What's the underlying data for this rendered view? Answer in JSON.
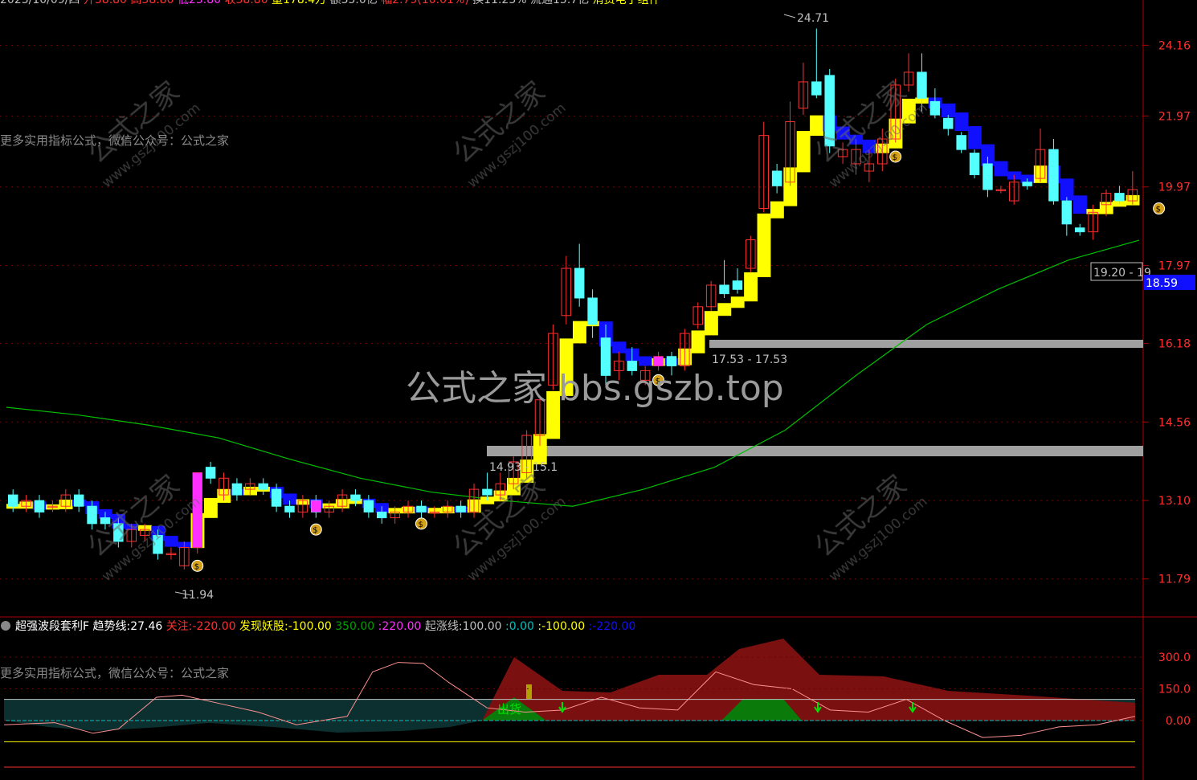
{
  "header": {
    "date": "2023/10/09/四",
    "items": [
      {
        "label": "开",
        "value": "38.80",
        "color": "#ff3030"
      },
      {
        "label": "高",
        "value": "38.80",
        "color": "#ff3030"
      },
      {
        "label": "低",
        "value": "25.80",
        "color": "#ff30ff"
      },
      {
        "label": "收",
        "value": "38.80",
        "color": "#ff3030"
      },
      {
        "label": "量",
        "value": "178.4万",
        "color": "#ffff00"
      },
      {
        "label": "额",
        "value": "35.0亿",
        "color": "#c0c0c0"
      },
      {
        "label": "幅",
        "value": "2.79(10.01%)",
        "color": "#ff3030"
      },
      {
        "label": "换",
        "value": "11.23%",
        "color": "#c0c0c0"
      },
      {
        "label": "流通",
        "value": "15.7亿",
        "color": "#c0c0c0"
      }
    ],
    "sector": "消费电子组件"
  },
  "watermark": {
    "center": "公式之家 bbs.gszb.top",
    "stamp_cn": "公式之家",
    "stamp_url": "www.gszj100.com",
    "side_text": "更多实用指标公式，微信公众号：公式之家"
  },
  "price_axis": {
    "ticks": [
      "24.16",
      "21.97",
      "19.97",
      "17.97",
      "16.18",
      "14.56",
      "13.10",
      "11.79"
    ],
    "current": "18.59",
    "current_color": "#1010ff"
  },
  "annotations": {
    "high": "24.71",
    "low": "11.94",
    "zone1": "14.93 - 15.1",
    "zone2": "17.53 - 17.53",
    "zone3": "19.20 - 19.",
    "sell_tag": "出货"
  },
  "indicator": {
    "name": "超强波段套利F",
    "legend": [
      {
        "label": "趋势线:",
        "value": "27.46",
        "color": "#ffffff"
      },
      {
        "label": "关注:",
        "value": "-220.00",
        "color": "#ff3030"
      },
      {
        "label": "发现妖股:",
        "value": "-100.00",
        "color": "#ffff00"
      },
      {
        "label": "",
        "value": "350.00",
        "color": "#00a000"
      },
      {
        "label": ":",
        "value": "220.00",
        "color": "#ff30ff"
      },
      {
        "label": "起涨线:",
        "value": "100.00",
        "color": "#c0c0c0"
      },
      {
        "label": ":",
        "value": "0.00",
        "color": "#00c0c0"
      },
      {
        "label": ":",
        "value": "-100.00",
        "color": "#ffff00"
      },
      {
        "label": ":",
        "value": "-220.00",
        "color": "#1010ff"
      }
    ],
    "ticks": [
      "300.0",
      "150.0",
      "0.00"
    ]
  },
  "colors": {
    "up": "#ff3030",
    "down": "#54ffff",
    "grid": "#7a0000",
    "trend_yellow": "#ffff00",
    "trend_blue": "#1010ff",
    "ma_green": "#00c000",
    "zone_gray": "#a0a0a0"
  },
  "chart_data": {
    "type": "candlestick",
    "ylim": [
      11.3,
      25.4
    ],
    "candles": [
      [
        13.2,
        13.0,
        13.3,
        12.9
      ],
      [
        13.0,
        13.1,
        13.2,
        12.9
      ],
      [
        13.1,
        12.9,
        13.2,
        12.8
      ],
      [
        13.0,
        13.0,
        13.1,
        12.9
      ],
      [
        13.0,
        13.2,
        13.3,
        12.9
      ],
      [
        13.2,
        13.0,
        13.3,
        12.9
      ],
      [
        13.0,
        12.7,
        13.1,
        12.6
      ],
      [
        12.8,
        12.7,
        12.9,
        12.6
      ],
      [
        12.7,
        12.4,
        12.8,
        12.3
      ],
      [
        12.4,
        12.6,
        12.7,
        12.3
      ],
      [
        12.5,
        12.6,
        12.7,
        12.4
      ],
      [
        12.5,
        12.2,
        12.6,
        12.1
      ],
      [
        12.2,
        12.2,
        12.3,
        12.1
      ],
      [
        12.0,
        12.3,
        12.4,
        11.94
      ],
      [
        12.3,
        13.6,
        13.6,
        12.2
      ],
      [
        13.7,
        13.5,
        13.8,
        13.4
      ],
      [
        13.2,
        13.5,
        13.6,
        13.1
      ],
      [
        13.4,
        13.2,
        13.5,
        13.1
      ],
      [
        13.3,
        13.4,
        13.5,
        13.2
      ],
      [
        13.4,
        13.3,
        13.5,
        13.2
      ],
      [
        13.3,
        13.0,
        13.4,
        12.9
      ],
      [
        13.0,
        12.9,
        13.1,
        12.8
      ],
      [
        12.9,
        13.1,
        13.2,
        12.8
      ],
      [
        13.1,
        12.9,
        13.2,
        12.8
      ],
      [
        12.9,
        13.0,
        13.1,
        12.8
      ],
      [
        13.0,
        13.2,
        13.3,
        12.9
      ],
      [
        13.2,
        13.1,
        13.3,
        13.0
      ],
      [
        13.1,
        12.9,
        13.2,
        12.8
      ],
      [
        12.9,
        12.8,
        13.0,
        12.7
      ],
      [
        12.8,
        12.9,
        13.0,
        12.7
      ],
      [
        12.9,
        13.0,
        13.1,
        12.8
      ],
      [
        13.0,
        12.9,
        13.1,
        12.8
      ],
      [
        12.9,
        12.9,
        13.0,
        12.8
      ],
      [
        12.9,
        13.0,
        13.1,
        12.8
      ],
      [
        13.0,
        12.9,
        13.1,
        12.8
      ],
      [
        12.9,
        13.3,
        13.4,
        12.8
      ],
      [
        13.3,
        13.2,
        13.6,
        13.1
      ],
      [
        13.2,
        13.4,
        13.6,
        13.1
      ],
      [
        13.4,
        13.8,
        13.9,
        13.3
      ],
      [
        13.6,
        14.3,
        14.4,
        13.5
      ],
      [
        14.3,
        15.0,
        15.0,
        14.1
      ],
      [
        15.3,
        16.4,
        16.6,
        15.2
      ],
      [
        16.8,
        17.9,
        18.2,
        16.6
      ],
      [
        17.9,
        17.2,
        18.5,
        17.0
      ],
      [
        17.2,
        16.6,
        17.4,
        16.3
      ],
      [
        16.3,
        15.5,
        16.6,
        15.3
      ],
      [
        15.6,
        15.8,
        16.0,
        15.4
      ],
      [
        15.8,
        15.6,
        16.1,
        15.5
      ],
      [
        15.4,
        15.6,
        15.7,
        15.3
      ],
      [
        15.7,
        15.9,
        16.0,
        15.6
      ],
      [
        15.9,
        15.7,
        16.0,
        15.5
      ],
      [
        15.7,
        16.4,
        16.5,
        15.6
      ],
      [
        16.6,
        17.0,
        17.1,
        16.5
      ],
      [
        17.0,
        17.5,
        17.6,
        16.9
      ],
      [
        17.5,
        17.3,
        18.1,
        17.2
      ],
      [
        17.6,
        17.4,
        17.9,
        17.3
      ],
      [
        17.9,
        18.6,
        18.7,
        17.8
      ],
      [
        19.4,
        21.4,
        21.8,
        19.3
      ],
      [
        20.4,
        20.0,
        20.6,
        19.8
      ],
      [
        20.1,
        21.8,
        22.4,
        20.0
      ],
      [
        22.2,
        23.0,
        23.6,
        22.0
      ],
      [
        23.0,
        22.6,
        24.71,
        22.5
      ],
      [
        23.2,
        21.1,
        23.4,
        20.9
      ],
      [
        20.8,
        21.0,
        21.2,
        20.6
      ],
      [
        20.6,
        21.0,
        21.3,
        20.3
      ],
      [
        20.4,
        20.6,
        21.0,
        20.1
      ],
      [
        20.6,
        21.3,
        21.6,
        20.4
      ],
      [
        21.3,
        22.9,
        23.1,
        21.2
      ],
      [
        22.9,
        23.3,
        23.9,
        22.7
      ],
      [
        23.3,
        22.5,
        23.9,
        22.1
      ],
      [
        22.4,
        22.0,
        22.8,
        21.9
      ],
      [
        21.9,
        21.6,
        22.0,
        21.4
      ],
      [
        21.4,
        21.0,
        21.5,
        20.9
      ],
      [
        20.9,
        20.3,
        21.0,
        20.2
      ],
      [
        20.6,
        19.9,
        20.8,
        19.7
      ],
      [
        19.9,
        19.9,
        20.0,
        19.8
      ],
      [
        19.6,
        20.1,
        20.3,
        19.5
      ],
      [
        20.1,
        20.0,
        20.2,
        19.9
      ],
      [
        20.2,
        21.0,
        21.6,
        20.1
      ],
      [
        21.0,
        19.6,
        21.3,
        19.5
      ],
      [
        19.6,
        19.0,
        19.7,
        18.7
      ],
      [
        18.9,
        18.8,
        19.0,
        18.7
      ],
      [
        18.8,
        19.3,
        19.5,
        18.6
      ],
      [
        19.5,
        19.8,
        19.9,
        19.2
      ],
      [
        19.8,
        19.6,
        20.0,
        19.5
      ],
      [
        19.6,
        19.9,
        20.4,
        19.5
      ]
    ],
    "ma": [
      [
        0,
        14.85
      ],
      [
        10,
        14.7
      ],
      [
        20,
        14.5
      ],
      [
        30,
        14.25
      ],
      [
        40,
        13.85
      ],
      [
        50,
        13.5
      ],
      [
        60,
        13.25
      ],
      [
        70,
        13.1
      ],
      [
        80,
        13.0
      ],
      [
        90,
        13.3
      ],
      [
        100,
        13.7
      ],
      [
        110,
        14.4
      ],
      [
        120,
        15.5
      ],
      [
        130,
        16.6
      ],
      [
        140,
        17.4
      ],
      [
        150,
        18.1
      ],
      [
        160,
        18.59
      ]
    ],
    "indicator_line": [
      [
        0,
        -20
      ],
      [
        8,
        -10
      ],
      [
        14,
        -60
      ],
      [
        18,
        -40
      ],
      [
        24,
        110
      ],
      [
        28,
        120
      ],
      [
        34,
        80
      ],
      [
        40,
        40
      ],
      [
        46,
        -20
      ],
      [
        50,
        0
      ],
      [
        54,
        20
      ],
      [
        58,
        230
      ],
      [
        62,
        275
      ],
      [
        66,
        270
      ],
      [
        70,
        180
      ],
      [
        76,
        60
      ],
      [
        82,
        40
      ],
      [
        88,
        50
      ],
      [
        94,
        110
      ],
      [
        100,
        60
      ],
      [
        106,
        50
      ],
      [
        112,
        230
      ],
      [
        118,
        170
      ],
      [
        124,
        150
      ],
      [
        130,
        50
      ],
      [
        136,
        40
      ],
      [
        142,
        100
      ],
      [
        148,
        0
      ],
      [
        154,
        -80
      ],
      [
        160,
        -70
      ],
      [
        166,
        -30
      ],
      [
        172,
        -20
      ],
      [
        178,
        20
      ]
    ]
  }
}
